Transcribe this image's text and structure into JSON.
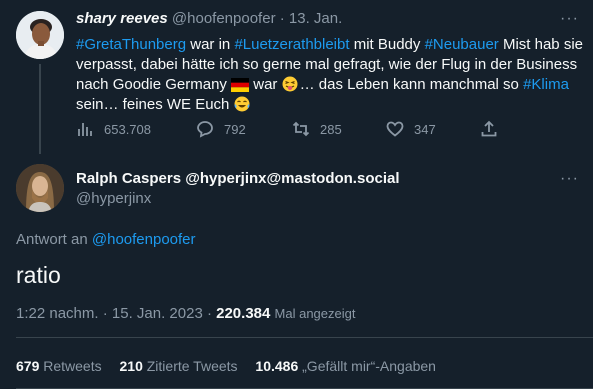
{
  "tweet1": {
    "author_name": "shary reeves",
    "author_handle": "@hoofenpoofer",
    "date": "13. Jan.",
    "body": {
      "hashtag1": "#GretaThunberg",
      "t1": " war in ",
      "hashtag2": "#Luetzerathbleibt",
      "t2": " mit Buddy ",
      "hashtag3": "#Neubauer",
      "t3": " Mist hab sie verpasst, dabei hätte ich so gerne mal gefragt, wie der Flug in der Business nach Goodie Germany ",
      "t4": " war ",
      "t5": "… das Leben kann manchmal so ",
      "hashtag4": "#Klima",
      "t6": " sein… feines WE Euch "
    },
    "stats": {
      "views": "653.708",
      "replies": "792",
      "retweets": "285",
      "likes": "347"
    },
    "icons": [
      "views-icon",
      "reply-icon",
      "retweet-icon",
      "like-icon",
      "share-icon"
    ]
  },
  "tweet2": {
    "author_name": "Ralph Caspers @hyperjinx@mastodon.social",
    "author_handle": "@hyperjinx",
    "reply_prefix": "Antwort an ",
    "reply_to": "@hoofenpoofer",
    "text": "ratio",
    "time": "1:22 nachm. · 15. Jan. 2023 · ",
    "views": "220.384",
    "views_label": "Mal angezeigt",
    "retweets": "679",
    "retweets_label": "Retweets",
    "quotes": "210",
    "quotes_label": "Zitierte Tweets",
    "likes": "10.486",
    "likes_label": "„Gefällt mir“-Angaben"
  },
  "colors": {
    "background": "#15202b",
    "link": "#1d9bf0",
    "muted": "#8b98a5",
    "text": "#f7f9f9",
    "divider": "#38444d"
  }
}
